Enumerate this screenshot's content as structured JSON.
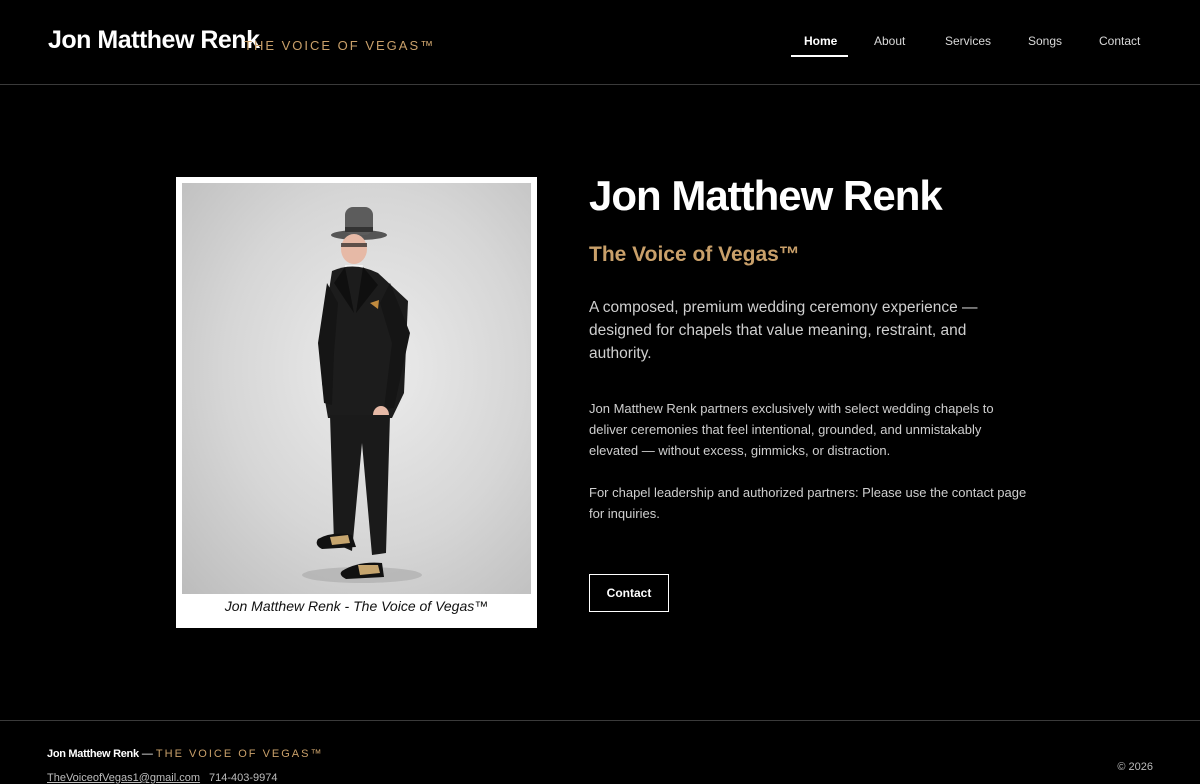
{
  "header": {
    "brand_name": "Jon Matthew Renk",
    "brand_tagline": "THE VOICE OF VEGAS™",
    "nav": [
      {
        "label": "Home",
        "active": true
      },
      {
        "label": "About",
        "active": false
      },
      {
        "label": "Services",
        "active": false
      },
      {
        "label": "Songs",
        "active": false
      },
      {
        "label": "Contact",
        "active": false
      }
    ]
  },
  "hero": {
    "photo_caption": "Jon Matthew Renk - The Voice of Vegas™",
    "title": "Jon Matthew Renk",
    "subtitle": "The Voice of Vegas™",
    "lead": "A composed, premium wedding ceremony experience — designed for chapels that value meaning, restraint, and authority.",
    "body_1": "Jon Matthew Renk partners exclusively with select wedding chapels to deliver ceremonies that feel intentional, grounded, and unmistakably elevated — without excess, gimmicks, or distraction.",
    "body_2": "For chapel leadership and authorized partners: Please use the contact page for inquiries.",
    "cta_label": "Contact"
  },
  "footer": {
    "brand_name": "Jon Matthew Renk",
    "separator": "—",
    "brand_tagline": "THE VOICE OF VEGAS™",
    "email": "TheVoiceofVegas1@gmail.com",
    "phone": "714-403-9974",
    "copyright": "© 2026"
  },
  "colors": {
    "background": "#000000",
    "accent_gold": "#c9a06a",
    "text_primary": "#ffffff",
    "text_secondary": "#cfcfcf"
  }
}
